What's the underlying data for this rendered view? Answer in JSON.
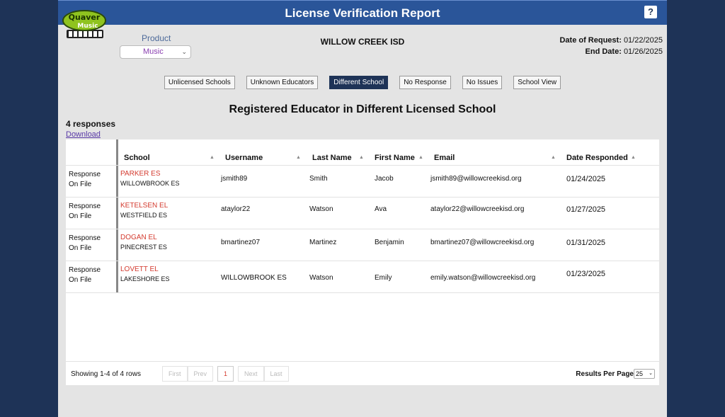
{
  "header": {
    "title": "License Verification Report",
    "help_label": "?"
  },
  "logo": {
    "text_top": "Quaver",
    "text_bottom": "Music"
  },
  "product": {
    "label": "Product",
    "selected": "Music"
  },
  "district": "WILLOW CREEK ISD",
  "dates": {
    "request_label": "Date of Request:",
    "request_value": "01/22/2025",
    "end_label": "End Date:",
    "end_value": "01/26/2025"
  },
  "tabs": [
    {
      "label": "Unlicensed Schools",
      "active": false
    },
    {
      "label": "Unknown Educators",
      "active": false
    },
    {
      "label": "Different School",
      "active": true
    },
    {
      "label": "No Response",
      "active": false
    },
    {
      "label": "No Issues",
      "active": false
    },
    {
      "label": "School View",
      "active": false
    }
  ],
  "report_title": "Registered Educator in Different Licensed School",
  "responses_count": "4 responses",
  "download_label": "Download",
  "table": {
    "columns": [
      "School",
      "Username",
      "Last Name",
      "First Name",
      "Email",
      "Date Responded"
    ],
    "rows": [
      {
        "status_1": "Response",
        "status_2": "On File",
        "school": "PARKER ES",
        "sub": "WILLOWBROOK ES",
        "username": "jsmith89",
        "last": "Smith",
        "first": "Jacob",
        "email": "jsmith89@willowcreekisd.org",
        "date": "01/24/2025"
      },
      {
        "status_1": "Response",
        "status_2": "On File",
        "school": "KETELSEN EL",
        "sub": "WESTFIELD ES",
        "username": "ataylor22",
        "last": "Watson",
        "first": "Ava",
        "email": "ataylor22@willowcreekisd.org",
        "date": "01/27/2025"
      },
      {
        "status_1": "Response",
        "status_2": "On File",
        "school": "DOGAN EL",
        "sub": "PINECREST ES",
        "username": "bmartinez07",
        "last": "Martinez",
        "first": "Benjamin",
        "email": "bmartinez07@willowcreekisd.org",
        "date": "01/31/2025"
      },
      {
        "status_1": "Response",
        "status_2": "On File",
        "school": "LOVETT EL",
        "sub": "LAKESHORE ES",
        "username": "WILLOWBROOK ES",
        "last": "Watson",
        "first": "Emily",
        "email": "emily.watson@willowcreekisd.org",
        "date": "01/23/2025"
      }
    ]
  },
  "footer": {
    "showing": "Showing 1-4 of 4 rows",
    "pager": {
      "first": "First",
      "prev": "Prev",
      "current": "1",
      "next": "Next",
      "last": "Last"
    },
    "results_per_page_label": "Results Per Page",
    "results_per_page_value": "25"
  }
}
